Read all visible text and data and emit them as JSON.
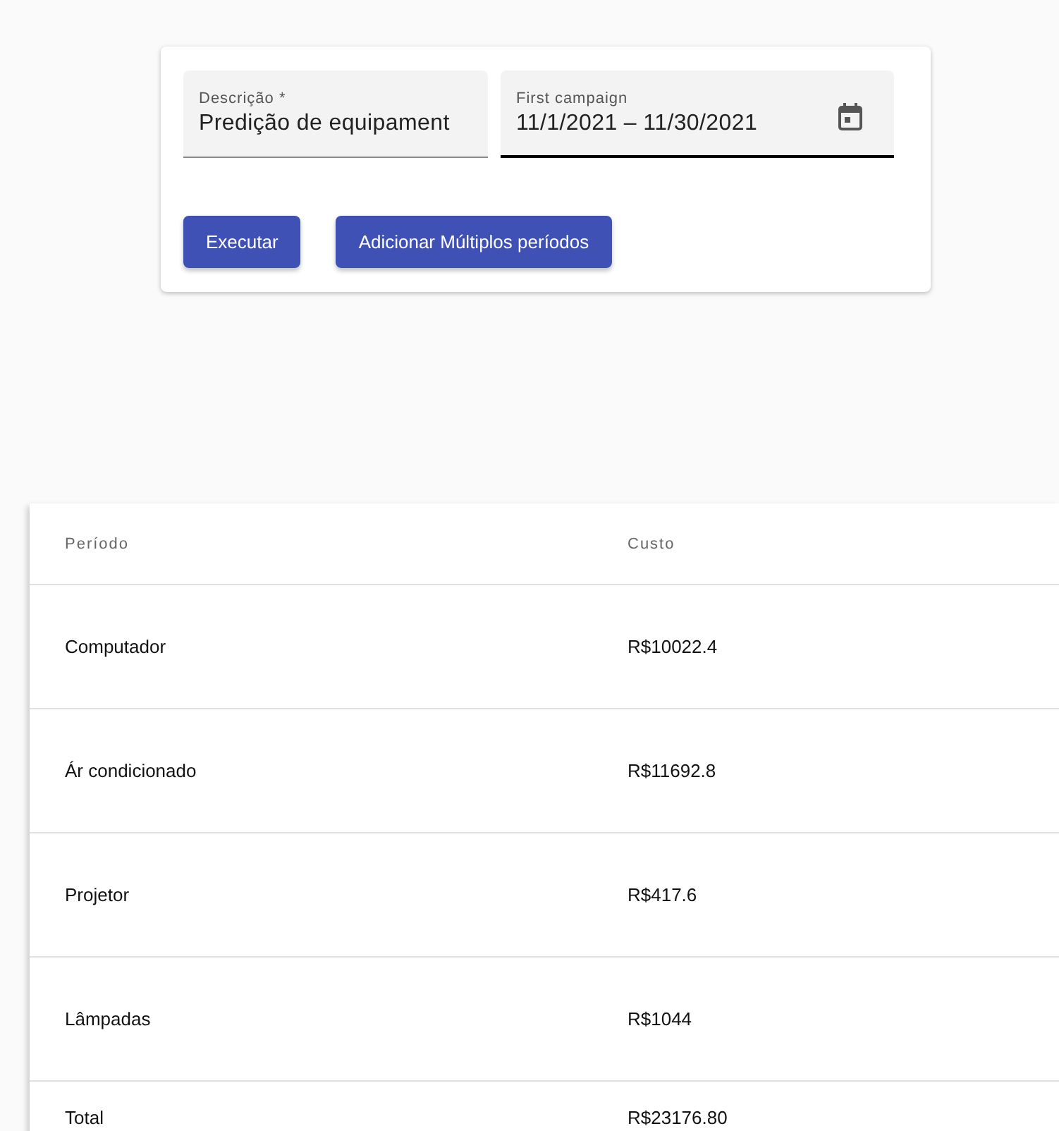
{
  "form": {
    "fields": [
      {
        "kind": "text",
        "label": "Descrição *",
        "value": "Predição de equipament",
        "focused": false
      },
      {
        "kind": "date",
        "label": "First campaign",
        "value": "11/1/2021 – 11/30/2021",
        "focused": true
      }
    ],
    "buttons": [
      "Executar",
      "Adicionar Múltiplos períodos"
    ]
  },
  "table": {
    "columns": [
      "Período",
      "Custo"
    ],
    "rows": [
      [
        "Computador",
        "R$10022.4"
      ],
      [
        "Ár condicionado",
        "R$11692.8"
      ],
      [
        "Projetor",
        "R$417.6"
      ],
      [
        "Lâmpadas",
        "R$1044"
      ],
      [
        "Total",
        "R$23176.80"
      ]
    ]
  }
}
